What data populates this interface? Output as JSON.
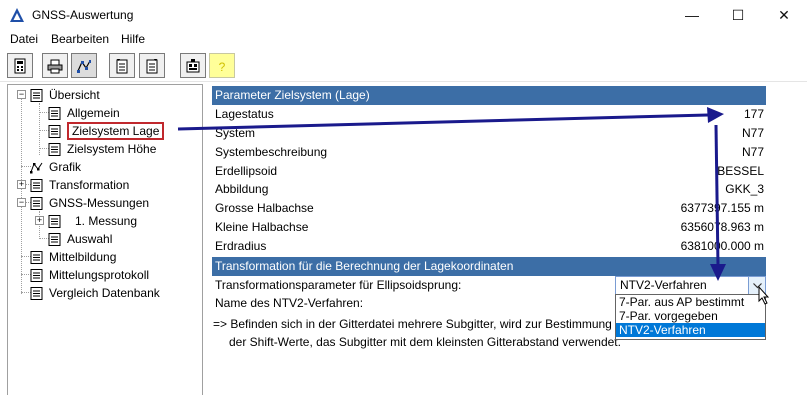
{
  "window": {
    "title": "GNSS-Auswertung",
    "minimize": "—",
    "maximize": "☐",
    "close": "✕"
  },
  "menu": [
    "Datei",
    "Bearbeiten",
    "Hilfe"
  ],
  "toolbar": {
    "buttons": [
      "calculator-icon",
      "printer-icon",
      "graph-icon",
      "doc-import-icon",
      "doc-export-icon",
      "database-icon",
      "help-icon"
    ]
  },
  "tree": {
    "items": [
      {
        "label": "Übersicht",
        "icon": "list-icon"
      },
      {
        "label": "Allgemein",
        "icon": "list-icon"
      },
      {
        "label": "Zielsystem Lage",
        "icon": "list-icon"
      },
      {
        "label": "Zielsystem Höhe",
        "icon": "list-icon"
      },
      {
        "label": "Grafik",
        "icon": "graph-icon"
      },
      {
        "label": "Transformation",
        "icon": "list-icon"
      },
      {
        "label": "GNSS-Messungen",
        "icon": "list-icon"
      },
      {
        "label": "1. Messung",
        "icon": "list-icon"
      },
      {
        "label": "Auswahl",
        "icon": "list-icon"
      },
      {
        "label": "Mittelbildung",
        "icon": "list-icon"
      },
      {
        "label": "Mittelungsprotokoll",
        "icon": "list-icon"
      },
      {
        "label": "Vergleich Datenbank",
        "icon": "list-icon"
      }
    ]
  },
  "main": {
    "section1_title": "Parameter Zielsystem (Lage)",
    "rows": [
      {
        "label": "Lagestatus",
        "value": "177"
      },
      {
        "label": "System",
        "value": "N77"
      },
      {
        "label": "Systembeschreibung",
        "value": "N77"
      },
      {
        "label": "Erdellipsoid",
        "value": "BESSEL"
      },
      {
        "label": "Abbildung",
        "value": "GKK_3"
      },
      {
        "label": "Grosse Halbachse",
        "value": "6377397.155 m"
      },
      {
        "label": "Kleine Halbachse",
        "value": "6356078.963 m"
      },
      {
        "label": "Erdradius",
        "value": "6381000.000 m"
      }
    ],
    "section2_title": "Transformation für die Berechnung der Lagekoordinaten",
    "trafo_label": "Transformationsparameter für Ellipsoidsprung:",
    "combo_value": "NTV2-Verfahren",
    "combo_options": [
      "7-Par. aus AP bestimmt",
      "7-Par. vorgegeben",
      "NTV2-Verfahren"
    ],
    "ntv2_label": "Name des NTV2-Verfahren:",
    "note_line1": "=> Befinden sich in der Gitterdatei mehrere Subgitter, wird zur Bestimmung",
    "note_line2": "der Shift-Werte, das Subgitter mit dem kleinsten Gitterabstand verwendet."
  },
  "colors": {
    "section_header": "#3c6ea6",
    "selection": "#0078d7",
    "annotation_arrow": "#1a1a8c",
    "highlight_box": "#c0282d"
  }
}
